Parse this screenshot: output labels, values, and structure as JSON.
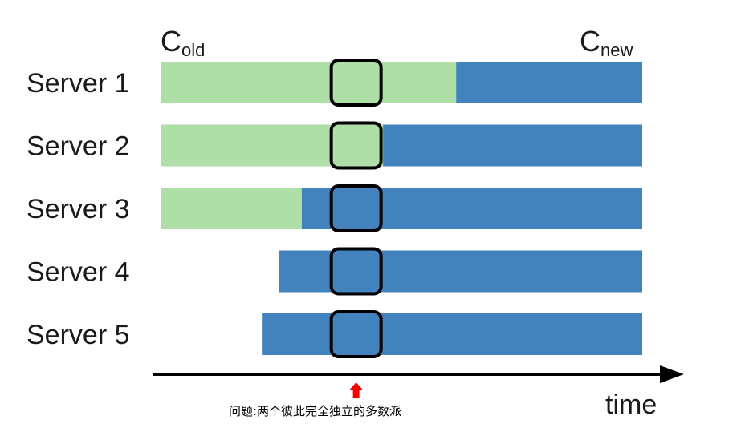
{
  "header": {
    "old_config": {
      "base": "C",
      "sub": "old"
    },
    "new_config": {
      "base": "C",
      "sub": "new"
    }
  },
  "servers": [
    {
      "label": "Server 1",
      "green_start": 0.0,
      "blue_start": 0.613
    },
    {
      "label": "Server 2",
      "green_start": 0.0,
      "blue_start": 0.461
    },
    {
      "label": "Server 3",
      "green_start": 0.0,
      "blue_start": 0.292
    },
    {
      "label": "Server 4",
      "green_start": null,
      "blue_start": 0.245
    },
    {
      "label": "Server 5",
      "green_start": null,
      "blue_start": 0.209
    }
  ],
  "axis": {
    "label": "time"
  },
  "highlight_time": 0.36,
  "caption": "问题:两个彼此完全独立的多数派",
  "colors": {
    "old": "#addfa7",
    "new": "#4283bd",
    "box": "#000000",
    "marker": "#ff0000"
  }
}
